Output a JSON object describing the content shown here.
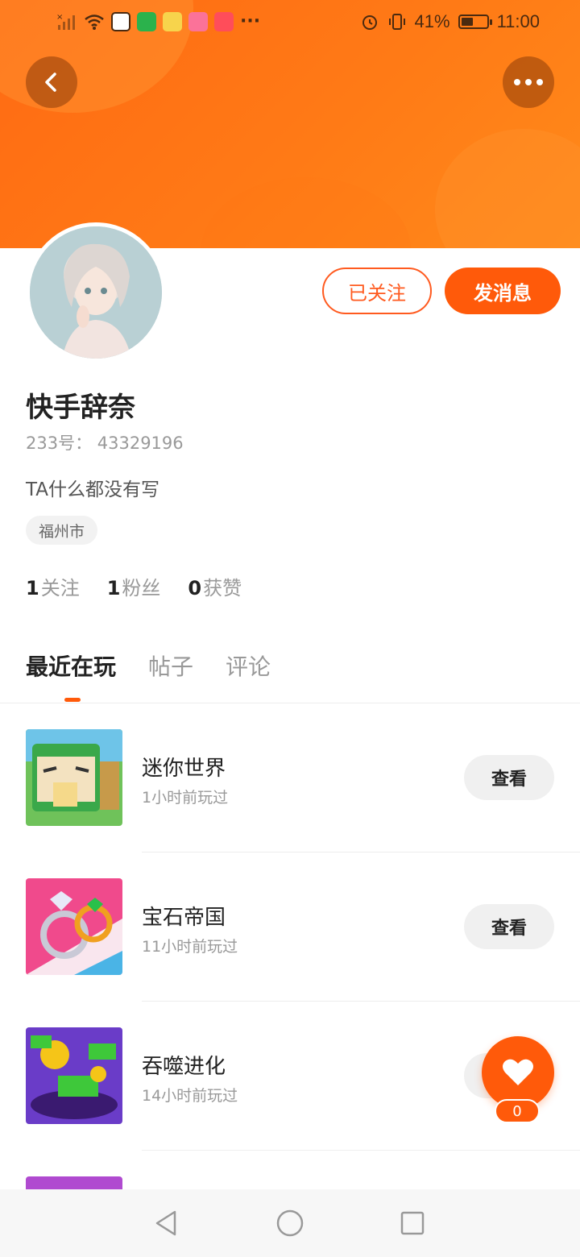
{
  "status_bar": {
    "battery_percent": "41%",
    "time": "11:00",
    "more_dots": "···"
  },
  "profile": {
    "follow_label": "已关注",
    "message_label": "发消息",
    "nickname": "快手辞奈",
    "uid_text": "233号：  43329196",
    "bio": "TA什么都没有写",
    "location": "福州市",
    "stats": [
      {
        "num": "1",
        "label": "关注"
      },
      {
        "num": "1",
        "label": "粉丝"
      },
      {
        "num": "0",
        "label": "获赞"
      }
    ]
  },
  "tabs": [
    {
      "label": "最近在玩",
      "active": true
    },
    {
      "label": "帖子",
      "active": false
    },
    {
      "label": "评论",
      "active": false
    }
  ],
  "games": [
    {
      "name": "迷你世界",
      "time": "1小时前玩过",
      "button": "查看"
    },
    {
      "name": "宝石帝国",
      "time": "11小时前玩过",
      "button": "查看"
    },
    {
      "name": "吞噬进化",
      "time": "14小时前玩过",
      "button": "查看"
    }
  ],
  "like_fab": {
    "count": "0"
  },
  "colors": {
    "accent": "#ff5a0a",
    "banner": "#ff7a16"
  }
}
